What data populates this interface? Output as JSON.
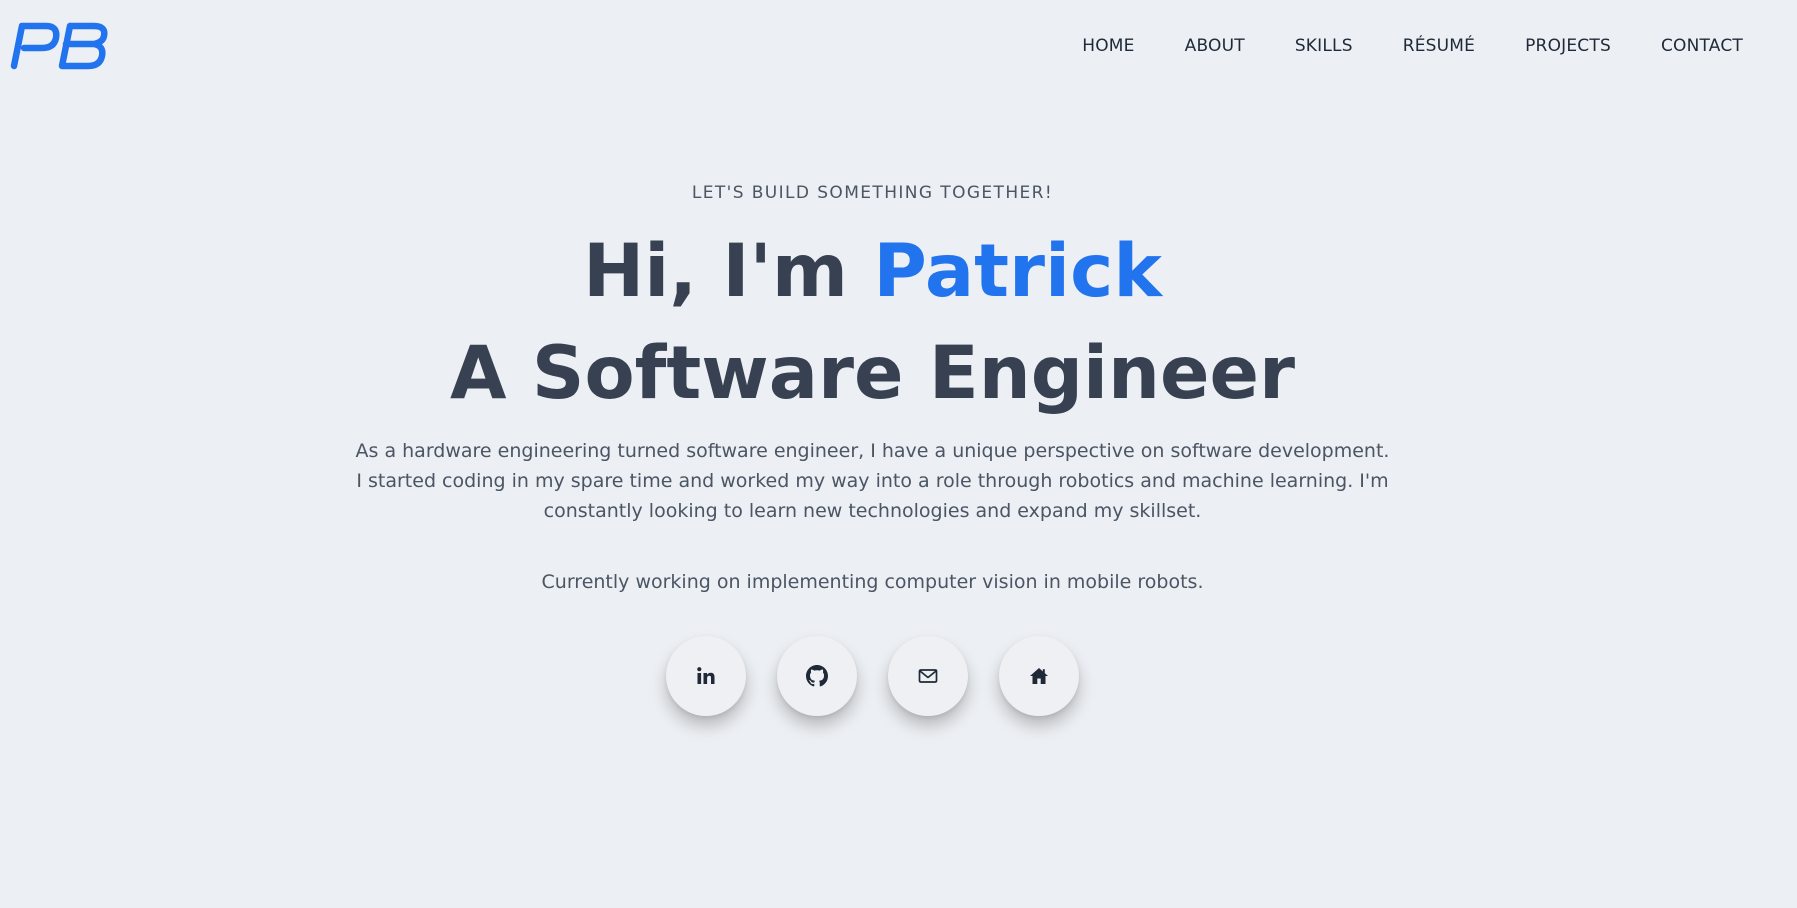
{
  "brand": {
    "logo_text": "PB",
    "accent_color": "#2174ee",
    "text_color": "#374151",
    "background_color": "#eceff3"
  },
  "nav": {
    "items": [
      {
        "label": "HOME"
      },
      {
        "label": "ABOUT"
      },
      {
        "label": "SKILLS"
      },
      {
        "label": "RÉSUMÉ"
      },
      {
        "label": "PROJECTS"
      },
      {
        "label": "CONTACT"
      }
    ]
  },
  "hero": {
    "eyebrow": "LET'S BUILD SOMETHING TOGETHER!",
    "greeting": "Hi, I'm ",
    "name": "Patrick",
    "role": "A Software Engineer",
    "bio": "As a hardware engineering turned software engineer, I have a unique perspective on software development. I started coding in my spare time and worked my way into a role through robotics and machine learning. I'm constantly looking to learn new technologies and expand my skillset.",
    "current": "Currently working on implementing computer vision in mobile robots."
  },
  "socials": [
    {
      "icon": "linkedin-icon"
    },
    {
      "icon": "github-icon"
    },
    {
      "icon": "mail-icon"
    },
    {
      "icon": "home-icon"
    }
  ]
}
